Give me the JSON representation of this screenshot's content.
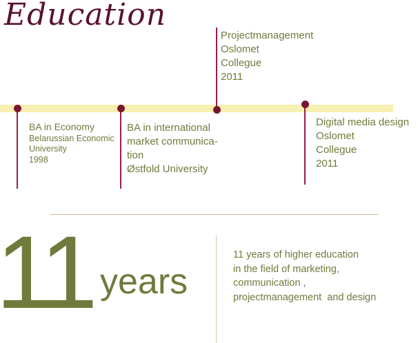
{
  "title": "Education",
  "timeline": [
    {
      "lines": [
        "BA in Economy",
        "Belarussian Economic",
        "University",
        "1998"
      ]
    },
    {
      "lines": [
        "BA in international",
        "market communica-",
        "tion",
        "Østfold University"
      ]
    },
    {
      "lines": [
        "Projectmanagement",
        "Oslomet",
        "Collegue",
        "2011"
      ]
    },
    {
      "lines": [
        "Digital media design",
        "Oslomet",
        "Collegue",
        "2011"
      ]
    }
  ],
  "summary": {
    "number": "11",
    "unit": "years",
    "text_lines": [
      "11 years of higher education",
      "in the field of marketing,",
      "communication ,",
      "projectmanagement  and design"
    ]
  },
  "colors": {
    "title": "#5a1130",
    "timeline_bar": "#f7f0b2",
    "marker": "#7a1530",
    "text": "#6e7b3c"
  }
}
